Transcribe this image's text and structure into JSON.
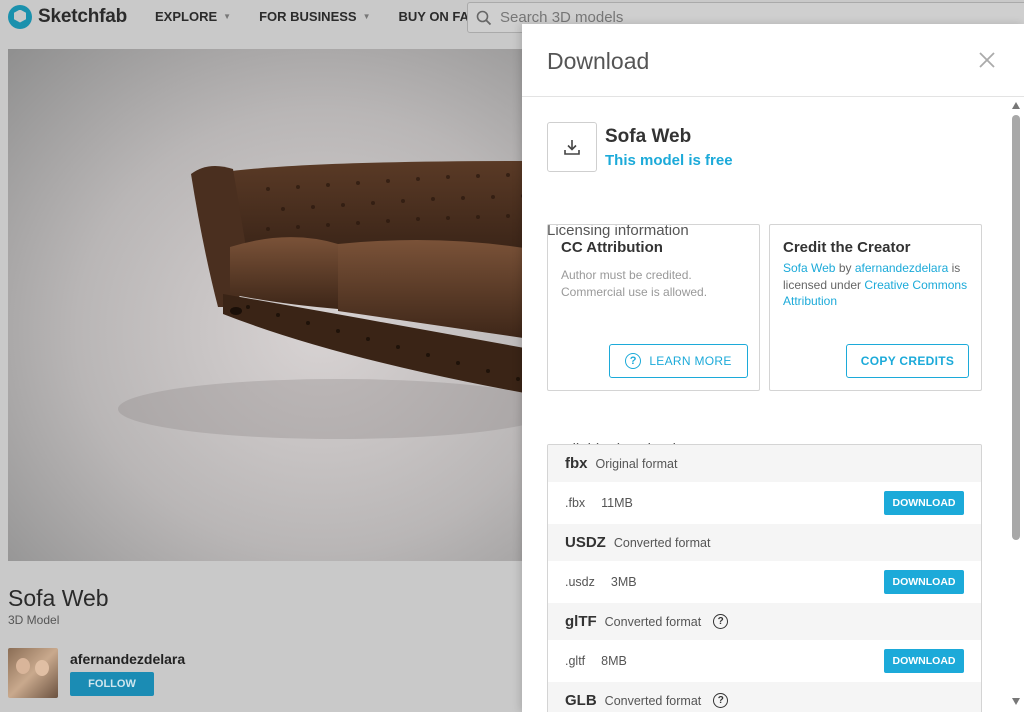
{
  "nav": {
    "brand": "Sketchfab",
    "explore": "EXPLORE",
    "for_business": "FOR BUSINESS",
    "buy_on_fab": "BUY ON FAB",
    "search_placeholder": "Search 3D models"
  },
  "model": {
    "title": "Sofa Web",
    "subtitle": "3D Model",
    "author": "afernandezdelara",
    "follow_label": "FOLLOW"
  },
  "modal": {
    "title": "Download",
    "model_name": "Sofa Web",
    "free_text": "This model is free",
    "licensing_label": "Licensing information",
    "license": {
      "title": "CC Attribution",
      "desc_line1": "Author must be credited.",
      "desc_line2": "Commercial use is allowed.",
      "learn_more": "LEARN MORE"
    },
    "credit": {
      "title": "Credit the Creator",
      "model_link": "Sofa Web",
      "by": "by",
      "author_link": "afernandezdelara",
      "licensed_under": "is licensed under",
      "license_link": "Creative Commons Attribution",
      "copy_credits": "COPY CREDITS"
    },
    "available_label": "Available downloads",
    "download_label": "DOWNLOAD",
    "formats": [
      {
        "name": "fbx",
        "type": "Original format",
        "ext": ".fbx",
        "size": "11MB"
      },
      {
        "name": "USDZ",
        "type": "Converted format",
        "ext": ".usdz",
        "size": "3MB"
      },
      {
        "name": "glTF",
        "type": "Converted format",
        "ext": ".gltf",
        "size": "8MB"
      },
      {
        "name": "GLB",
        "type": "Converted format"
      }
    ]
  },
  "colors": {
    "accent": "#1caad9",
    "brand": "#1b91ad"
  }
}
